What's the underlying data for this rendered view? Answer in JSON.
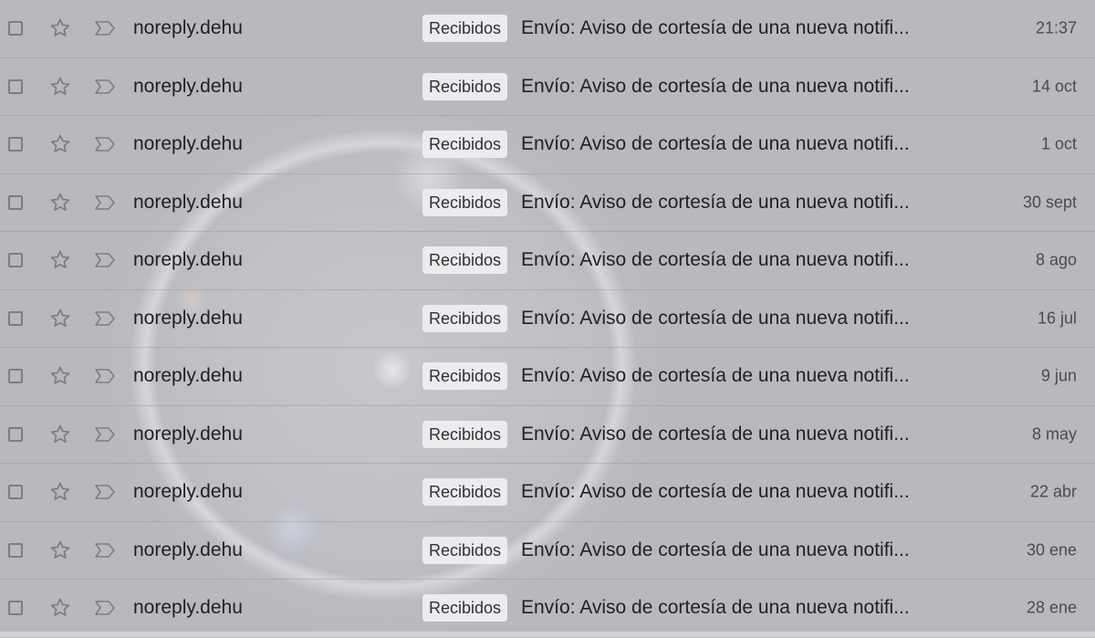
{
  "inbox": {
    "rows": [
      {
        "sender": "noreply.dehu",
        "label": "Recibidos",
        "subject": "Envío: Aviso de cortesía de una nueva notifi...",
        "date": "21:37"
      },
      {
        "sender": "noreply.dehu",
        "label": "Recibidos",
        "subject": "Envío: Aviso de cortesía de una nueva notifi...",
        "date": "14 oct"
      },
      {
        "sender": "noreply.dehu",
        "label": "Recibidos",
        "subject": "Envío: Aviso de cortesía de una nueva notifi...",
        "date": "1 oct"
      },
      {
        "sender": "noreply.dehu",
        "label": "Recibidos",
        "subject": "Envío: Aviso de cortesía de una nueva notifi...",
        "date": "30 sept"
      },
      {
        "sender": "noreply.dehu",
        "label": "Recibidos",
        "subject": "Envío: Aviso de cortesía de una nueva notifi...",
        "date": "8 ago"
      },
      {
        "sender": "noreply.dehu",
        "label": "Recibidos",
        "subject": "Envío: Aviso de cortesía de una nueva notifi...",
        "date": "16 jul"
      },
      {
        "sender": "noreply.dehu",
        "label": "Recibidos",
        "subject": "Envío: Aviso de cortesía de una nueva notifi...",
        "date": "9 jun"
      },
      {
        "sender": "noreply.dehu",
        "label": "Recibidos",
        "subject": "Envío: Aviso de cortesía de una nueva notifi...",
        "date": "8 may"
      },
      {
        "sender": "noreply.dehu",
        "label": "Recibidos",
        "subject": "Envío: Aviso de cortesía de una nueva notifi...",
        "date": "22 abr"
      },
      {
        "sender": "noreply.dehu",
        "label": "Recibidos",
        "subject": "Envío: Aviso de cortesía de una nueva notifi...",
        "date": "30 ene"
      },
      {
        "sender": "noreply.dehu",
        "label": "Recibidos",
        "subject": "Envío: Aviso de cortesía de una nueva notifi...",
        "date": "28 ene"
      }
    ]
  },
  "icons": {
    "checkbox": "checkbox-icon",
    "star": "star-icon",
    "important": "important-marker-icon"
  },
  "colors": {
    "icon_gray": "#7c7d84",
    "label_chip_bg": "#ececee",
    "text_primary": "#1f1f22"
  }
}
